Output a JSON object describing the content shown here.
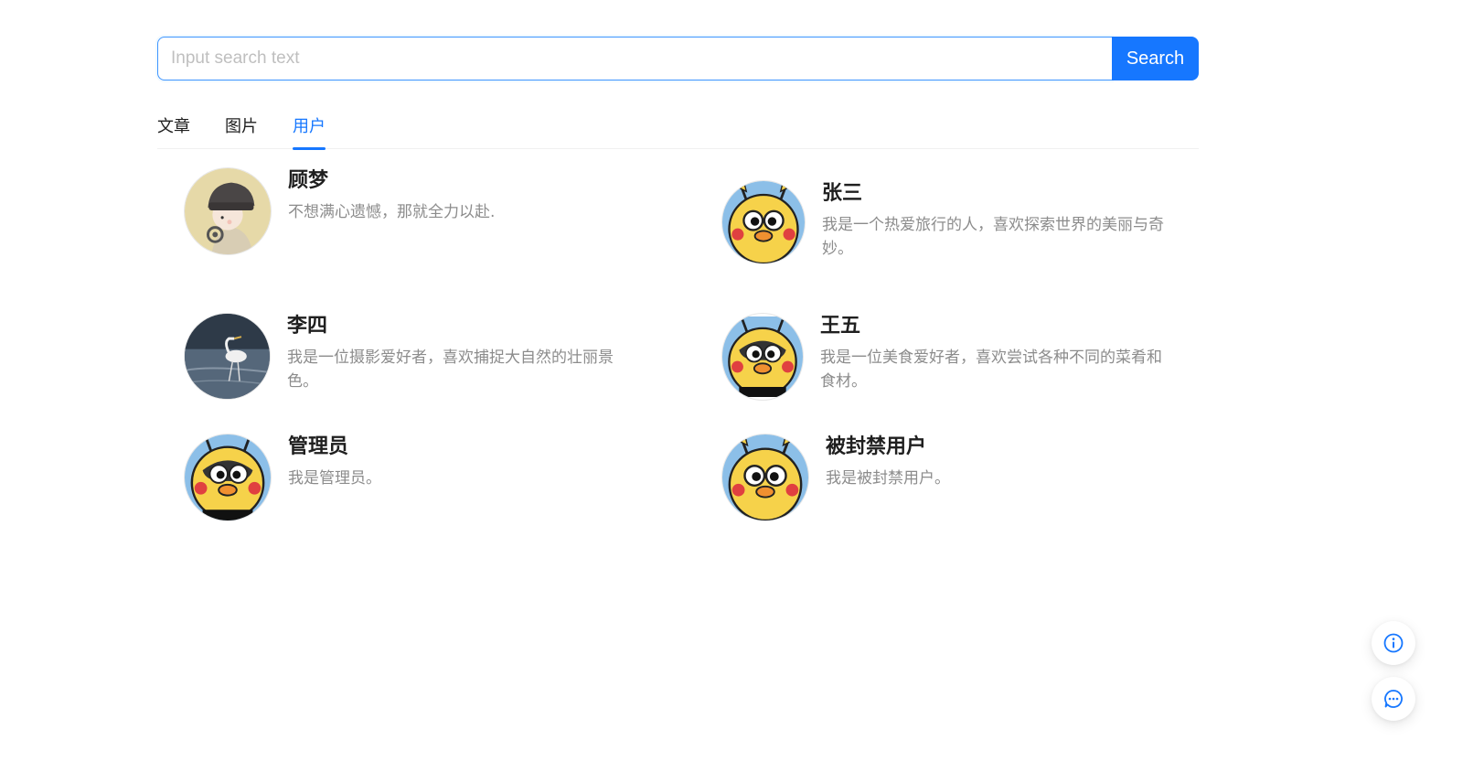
{
  "search": {
    "placeholder": "Input search text",
    "value": "",
    "button_label": "Search"
  },
  "tabs": [
    {
      "label": "文章",
      "active": false
    },
    {
      "label": "图片",
      "active": false
    },
    {
      "label": "用户",
      "active": true
    }
  ],
  "users": [
    {
      "name": "顾梦",
      "bio": "不想满心遗憾，那就全力以赴.",
      "avatar": "girl-hat-avatar"
    },
    {
      "name": "张三",
      "bio": "我是一个热爱旅行的人，喜欢探索世界的美丽与奇妙。",
      "avatar": "yellow-duck-avatar"
    },
    {
      "name": "李四",
      "bio": "我是一位摄影爱好者，喜欢捕捉大自然的壮丽景色。",
      "avatar": "heron-photo-avatar"
    },
    {
      "name": "王五",
      "bio": "我是一位美食爱好者，喜欢尝试各种不同的菜肴和食材。",
      "avatar": "dark-duck-avatar"
    },
    {
      "name": "管理员",
      "bio": "我是管理员。",
      "avatar": "dark-duck-avatar"
    },
    {
      "name": "被封禁用户",
      "bio": "我是被封禁用户。",
      "avatar": "yellow-duck-avatar"
    }
  ],
  "floating_buttons": [
    {
      "icon": "info-circle-icon"
    },
    {
      "icon": "message-icon"
    }
  ],
  "colors": {
    "primary": "#1677ff",
    "text": "#1f1f1f",
    "secondary_text": "#8c8c8c"
  }
}
